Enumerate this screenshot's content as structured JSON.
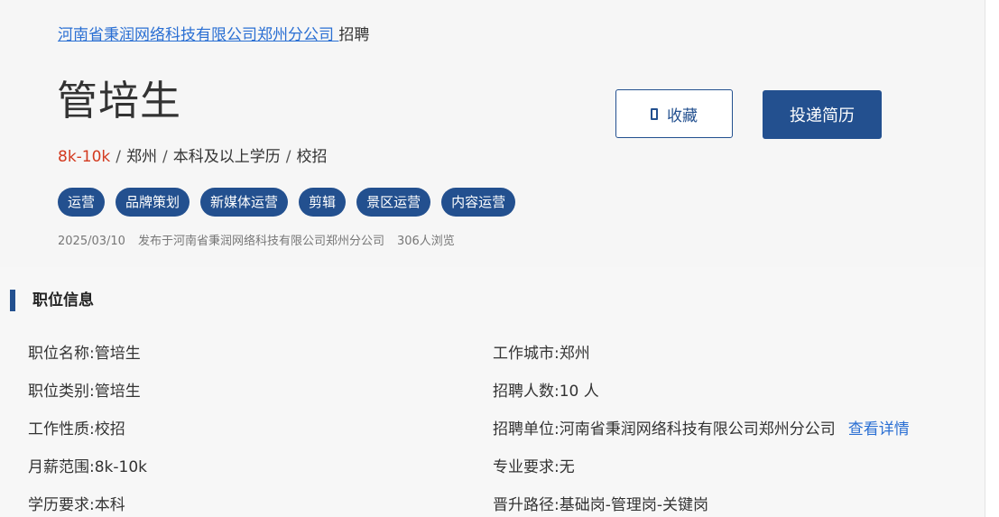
{
  "breadcrumb": {
    "company_link": "河南省秉润网络科技有限公司郑州分公司 ",
    "suffix": "招聘"
  },
  "job": {
    "title": "管培生",
    "salary": "8k-10k",
    "city": "郑州",
    "education": "本科及以上学历",
    "type": "校招",
    "separator": "/"
  },
  "tags": [
    "运营",
    "品牌策划",
    "新媒体运营",
    "剪辑",
    "景区运营",
    "内容运营"
  ],
  "meta": {
    "date": "2025/03/10",
    "publisher": "发布于河南省秉润网络科技有限公司郑州分公司",
    "views": "306人浏览"
  },
  "actions": {
    "collect_label": "收藏",
    "collect_icon": "bookmark-icon",
    "apply_label": "投递简历"
  },
  "section": {
    "title": "职位信息"
  },
  "info_left": [
    {
      "label": "职位名称:",
      "value": "管培生"
    },
    {
      "label": "职位类别:",
      "value": "管培生"
    },
    {
      "label": "工作性质:",
      "value": "校招"
    },
    {
      "label": "月薪范围:",
      "value": "8k-10k"
    },
    {
      "label": "学历要求:",
      "value": "本科"
    }
  ],
  "info_right": [
    {
      "label": "工作城市:",
      "value": "郑州"
    },
    {
      "label": "招聘人数:",
      "value": "10 人"
    },
    {
      "label": "招聘单位:",
      "value": "河南省秉润网络科技有限公司郑州分公司",
      "link": "查看详情"
    },
    {
      "label": "专业要求:",
      "value": "无"
    },
    {
      "label": "晋升路径:",
      "value": "基础岗-管理岗-关键岗"
    }
  ],
  "colors": {
    "primary": "#23508f",
    "link": "#2a6fd3",
    "salary": "#d33a1f"
  }
}
